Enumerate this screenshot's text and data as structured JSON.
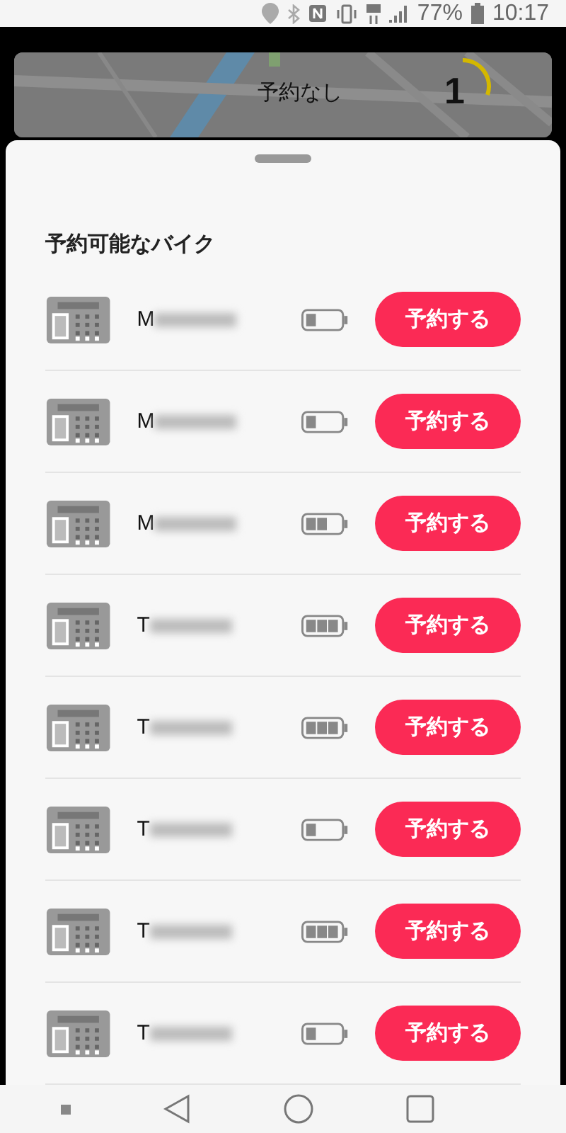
{
  "status_bar": {
    "battery": "77%",
    "time": "10:17"
  },
  "map_card": {
    "status": "予約なし",
    "count": "1"
  },
  "sheet": {
    "title": "予約可能なバイク",
    "bikes": [
      {
        "id_prefix": "M",
        "battery": {
          "kind": "low"
        },
        "button": "予約する"
      },
      {
        "id_prefix": "M",
        "battery": {
          "kind": "low"
        },
        "button": "予約する"
      },
      {
        "id_prefix": "M",
        "battery": {
          "kind": "half"
        },
        "button": "予約する"
      },
      {
        "id_prefix": "T",
        "battery": {
          "kind": "full"
        },
        "button": "予約する"
      },
      {
        "id_prefix": "T",
        "battery": {
          "kind": "full"
        },
        "button": "予約する"
      },
      {
        "id_prefix": "T",
        "battery": {
          "kind": "low"
        },
        "button": "予約する"
      },
      {
        "id_prefix": "T",
        "battery": {
          "kind": "full"
        },
        "button": "予約する"
      },
      {
        "id_prefix": "T",
        "battery": {
          "kind": "low"
        },
        "button": "予約する"
      }
    ]
  }
}
